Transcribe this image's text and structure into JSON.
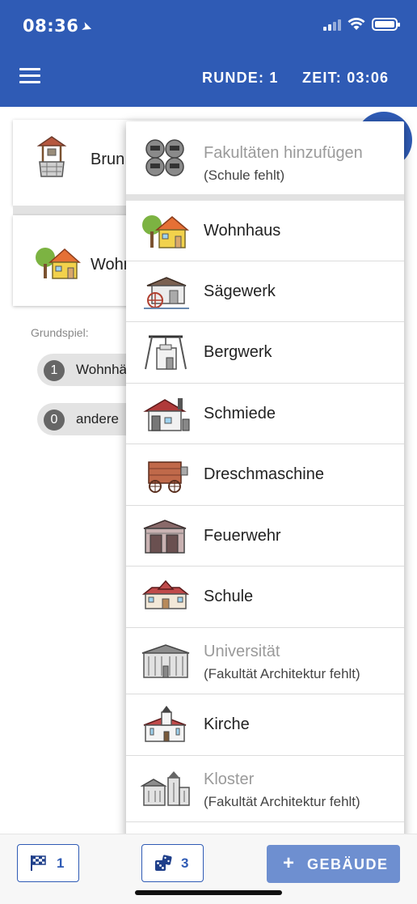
{
  "status_bar": {
    "time": "08:36"
  },
  "header": {
    "round": "RUNDE: 1",
    "time": "ZEIT: 03:06"
  },
  "cards": [
    {
      "label": "Brun",
      "icon": "well-icon"
    },
    {
      "label": "Wohn",
      "icon": "house-icon"
    }
  ],
  "section": {
    "caption": "Grundspiel:",
    "chips": [
      {
        "count": "1",
        "label": "Wohnhä"
      },
      {
        "count": "0",
        "label": "andere"
      }
    ]
  },
  "dropdown": {
    "header_item": {
      "title": "Fakultäten hinzufügen",
      "subtitle": "(Schule fehlt)",
      "icon": "faculties-icon"
    },
    "items": [
      {
        "title": "Wohnhaus",
        "subtitle": "",
        "icon": "house-icon",
        "disabled": false
      },
      {
        "title": "Sägewerk",
        "subtitle": "",
        "icon": "sawmill-icon",
        "disabled": false
      },
      {
        "title": "Bergwerk",
        "subtitle": "",
        "icon": "mine-icon",
        "disabled": false
      },
      {
        "title": "Schmiede",
        "subtitle": "",
        "icon": "smithy-icon",
        "disabled": false
      },
      {
        "title": "Dreschmaschine",
        "subtitle": "",
        "icon": "threshing-machine-icon",
        "disabled": false
      },
      {
        "title": "Feuerwehr",
        "subtitle": "",
        "icon": "fire-station-icon",
        "disabled": false
      },
      {
        "title": "Schule",
        "subtitle": "",
        "icon": "school-icon",
        "disabled": false
      },
      {
        "title": "Universität",
        "subtitle": "(Fakultät Architektur fehlt)",
        "icon": "university-icon",
        "disabled": true
      },
      {
        "title": "Kirche",
        "subtitle": "",
        "icon": "church-icon",
        "disabled": false
      },
      {
        "title": "Kloster",
        "subtitle": "(Fakultät Architektur fehlt)",
        "icon": "monastery-icon",
        "disabled": true
      }
    ]
  },
  "bottom_bar": {
    "flag_count": "1",
    "dice_count": "3",
    "add_button": "GEBÄUDE",
    "add_icon": "+"
  },
  "colors": {
    "primary": "#2f5bb5",
    "add_button": "#6e8fd0",
    "disabled_text": "#9a9a9a"
  }
}
